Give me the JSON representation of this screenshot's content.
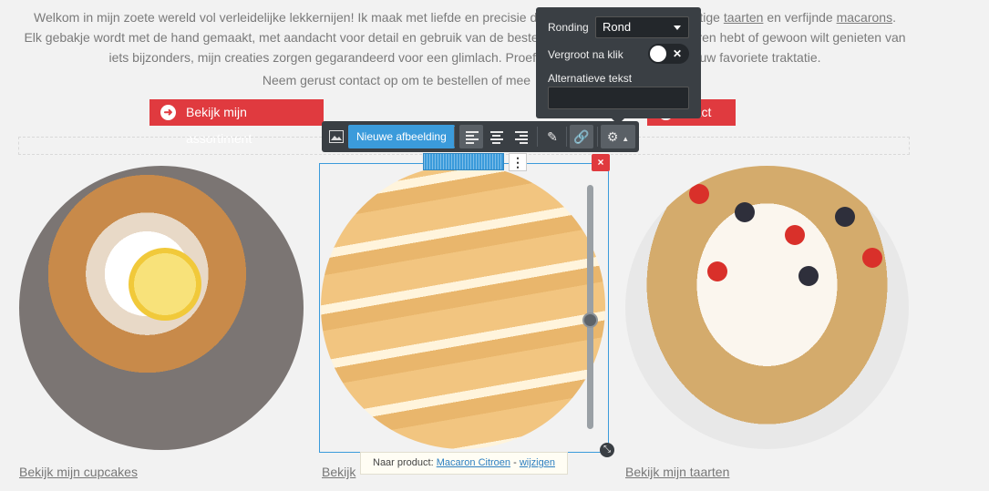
{
  "intro": {
    "line1_pre": "Welkom in mijn zoete wereld vol verleidelijke lekkernijen! Ik maak met liefde en precisie de m",
    "line1_mid": "chtige",
    "link_taarten": "taarten",
    "line1_and": "en verfijnde",
    "link_macarons": "macarons",
    "line1_end": ".",
    "line2_pre": "Elk gebakje wordt met de hand gemaakt, met aandacht voor detail en gebruik van de beste in",
    "line2_end": "ren hebt of gewoon wilt genieten van",
    "line3_pre": "iets bijzonders, mijn creaties zorgen gegarandeerd voor een glimlach. Proef de",
    "line3_end": "uw favoriete traktatie.",
    "contact_line": "Neem gerust contact op om te bestellen of mee"
  },
  "buttons": {
    "assortiment_label": "Bekijk mijn assortiment",
    "contact_label": "ntact"
  },
  "toolbar": {
    "new_image_label": "Nieuwe afbeelding",
    "icons": [
      "image-icon",
      "align-left-icon",
      "align-center-icon",
      "align-right-icon",
      "pencil-icon",
      "link-icon",
      "gear-icon"
    ]
  },
  "settings": {
    "ronding_label": "Ronding",
    "ronding_value": "Rond",
    "enlarge_label": "Vergroot na klik",
    "enlarge_on": false,
    "alt_label": "Alternatieve tekst",
    "alt_value": ""
  },
  "product_tip": {
    "prefix": "Naar product:",
    "product": "Macaron Citroen",
    "sep": "-",
    "change": "wijzigen"
  },
  "captions": {
    "cupcakes": "Bekijk mijn cupcakes",
    "macarons": "Bekijk",
    "taarten": "Bekijk mijn taarten"
  },
  "colors": {
    "accent_red": "#e03a3f",
    "accent_blue": "#3b9bdb",
    "toolbar_bg": "#3a3f44"
  }
}
